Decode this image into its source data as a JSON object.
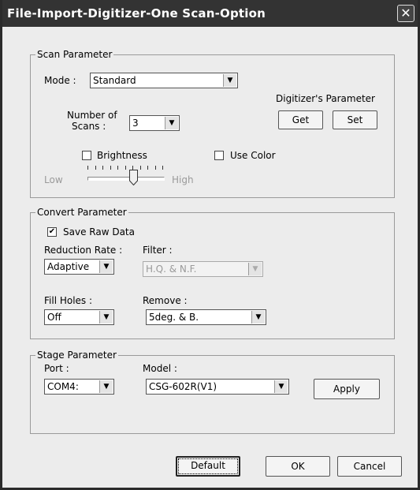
{
  "window": {
    "title": "File-Import-Digitizer-One Scan-Option",
    "close": "✕"
  },
  "scan": {
    "group_title": "Scan Parameter",
    "mode_label": "Mode :",
    "mode_value": "Standard",
    "scans_label_1": "Number of",
    "scans_label_2": "Scans :",
    "scans_value": "3",
    "digitizer_label": "Digitizer's Parameter",
    "get_button": "Get",
    "set_button": "Set",
    "brightness_label": "Brightness",
    "brightness_checked": false,
    "use_color_label": "Use Color",
    "use_color_checked": false,
    "low_label": "Low",
    "high_label": "High",
    "slider_level": 0.6
  },
  "convert": {
    "group_title": "Convert Parameter",
    "save_raw_label": "Save Raw Data",
    "save_raw_checked": true,
    "reduction_label": "Reduction Rate :",
    "reduction_value": "Adaptive",
    "filter_label": "Filter :",
    "filter_value": "H.Q. & N.F.",
    "fill_holes_label": "Fill Holes :",
    "fill_holes_value": "Off",
    "remove_label": "Remove :",
    "remove_value": "5deg. & B."
  },
  "stage": {
    "group_title": "Stage Parameter",
    "port_label": "Port :",
    "port_value": "COM4:",
    "model_label": "Model :",
    "model_value": "CSG-602R(V1)",
    "apply_button": "Apply"
  },
  "footer": {
    "default_button": "Default",
    "ok_button": "OK",
    "cancel_button": "Cancel"
  },
  "icons": {
    "dropdown": "▼",
    "check": "✔"
  }
}
